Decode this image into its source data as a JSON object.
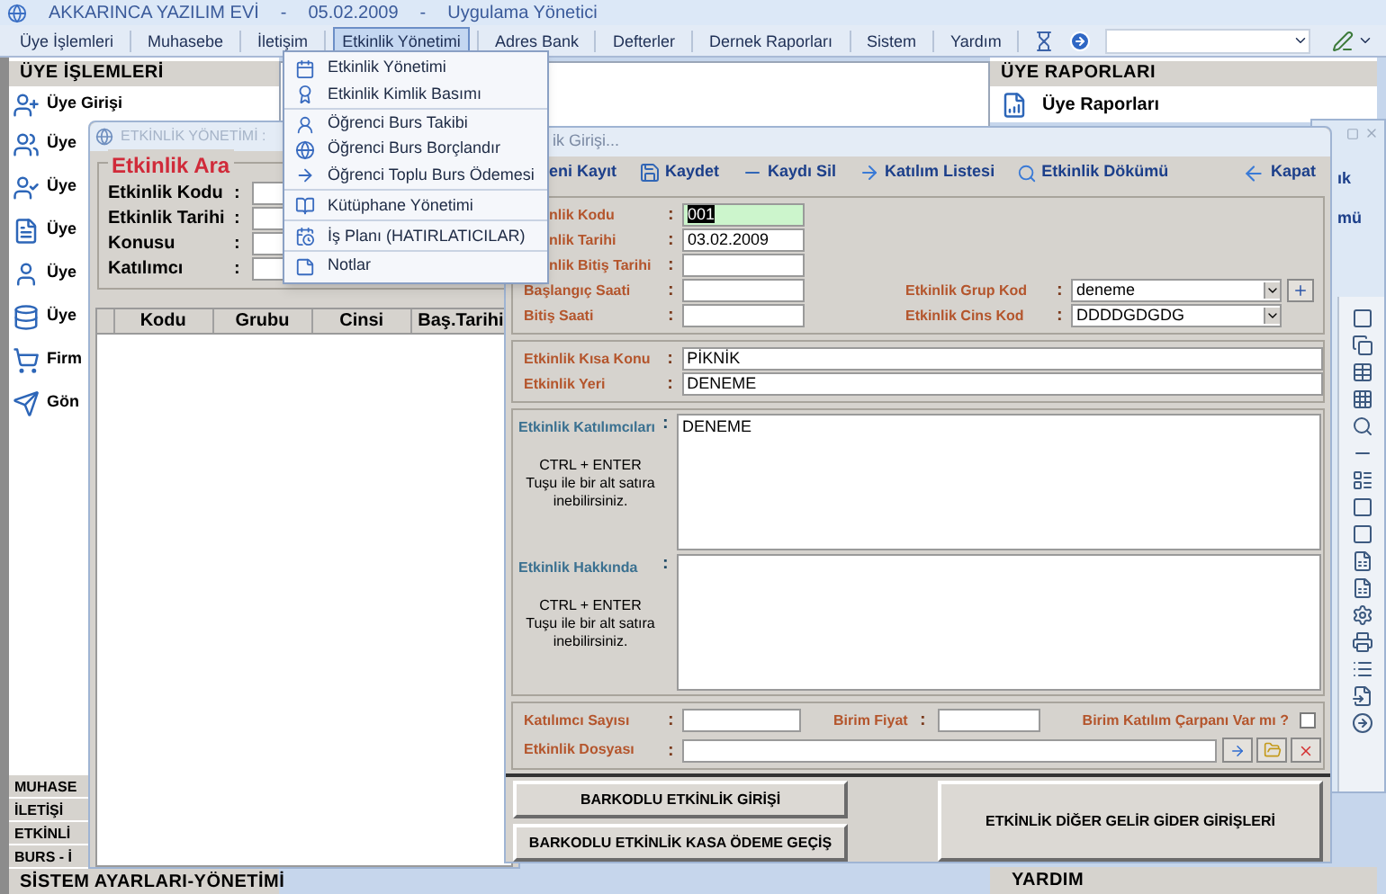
{
  "title_bar": {
    "parts": [
      "AKKARINCA YAZILIM EVİ",
      "-",
      "05.02.2009",
      "-",
      "Uygulama Yönetici"
    ]
  },
  "menu": [
    {
      "label": "Üye İşlemleri",
      "selected": false
    },
    {
      "label": "Muhasebe",
      "selected": false
    },
    {
      "label": "İletişim",
      "selected": false
    },
    {
      "label": "Etkinlik Yönetimi",
      "selected": true
    },
    {
      "label": "Adres Bank",
      "selected": false
    },
    {
      "label": "Defterler",
      "selected": false
    },
    {
      "label": "Dernek Raporları",
      "selected": false
    },
    {
      "label": "Sistem",
      "selected": false
    },
    {
      "label": "Yardım",
      "selected": false
    }
  ],
  "menu_dropdown": [
    {
      "label": "Etkinlik Yönetimi",
      "divider_after": false
    },
    {
      "label": "Etkinlik Kimlik Basımı",
      "divider_after": true
    },
    {
      "label": "Öğrenci Burs Takibi",
      "divider_after": false
    },
    {
      "label": "Öğrenci Burs Borçlandır",
      "divider_after": false
    },
    {
      "label": "Öğrenci Toplu Burs Ödemesi",
      "divider_after": true
    },
    {
      "label": "Kütüphane Yönetimi",
      "divider_after": true
    },
    {
      "label": "İş Planı (HATIRLATICILAR)",
      "divider_after": true
    },
    {
      "label": "Notlar",
      "divider_after": false
    }
  ],
  "left_panel": {
    "header": "ÜYE İŞLEMLERİ",
    "items": [
      "Üye Girişi",
      "Üye",
      "Üye",
      "Üye",
      "Üye",
      "Üye",
      "Firm",
      "Gön"
    ],
    "sections": [
      "MUHASE",
      "İLETİŞİ",
      "ETKİNLİ",
      "BURS - İ"
    ],
    "bottom_section": "SİSTEM AYARLARI-YÖNETİMİ"
  },
  "right_panel": {
    "header": "ÜYE RAPORLARI",
    "items": [
      "Üye Raporları"
    ],
    "bottom_header": "YARDIM"
  },
  "back_window": {
    "texts": [
      "ık",
      "mü"
    ]
  },
  "search_window": {
    "title": "ETKİNLİK YÖNETİMİ :",
    "group_title": "Etkinlik Ara",
    "fields": [
      {
        "label": "Etkinlik Kodu",
        "colon": ":"
      },
      {
        "label": "Etkinlik Tarihi",
        "colon": ":"
      },
      {
        "label": "Konusu",
        "colon": ":"
      },
      {
        "label": "Katılımcı",
        "colon": ":"
      }
    ],
    "columns": [
      "Kodu",
      "Grubu",
      "Cinsi",
      "Baş.Tarihi"
    ]
  },
  "entry_window": {
    "title": "ik Girişi...",
    "toolbar": [
      {
        "label": "eni Kayıt",
        "kind": "clipped"
      },
      {
        "label": "Kaydet",
        "kind": "save"
      },
      {
        "label": "Kaydı Sil",
        "kind": "delete"
      },
      {
        "label": "Katılım Listesi",
        "kind": "list"
      },
      {
        "label": "Etkinlik Dökümü",
        "kind": "report"
      }
    ],
    "close": "Kapat",
    "main_rows": [
      {
        "label": "nlik Kodu",
        "colon": ":",
        "value": "001",
        "kind": "clipped",
        "highlighted": true
      },
      {
        "label": "nlik Tarihi",
        "colon": ":",
        "value": "03.02.2009",
        "kind": "clipped",
        "highlighted": false
      },
      {
        "label": "nlik Bitiş Tarihi",
        "colon": ":",
        "kind": "clipped",
        "highlighted": false
      },
      {
        "label": "Başlangıç Saati",
        "colon": ":",
        "kind": "full",
        "highlighted": false
      },
      {
        "label": "Bitiş Saati",
        "colon": ":",
        "kind": "full",
        "highlighted": false
      }
    ],
    "side_rows": [
      {
        "label": "Etkinlik Grup Kod",
        "colon": ":",
        "value": "deneme",
        "add_button": true
      },
      {
        "label": "Etkinlik Cins Kod",
        "colon": ":",
        "value": "DDDDGDGDG",
        "add_button": false
      }
    ],
    "topic_rows": [
      {
        "label": "Etkinlik Kısa Konu",
        "colon": ":",
        "value": "PİKNİK"
      },
      {
        "label": "Etkinlik Yeri",
        "colon": ":",
        "value": "DENEME"
      }
    ],
    "text_areas": [
      {
        "label": "Etkinlik Katılımcıları",
        "colon": ":",
        "value": "DENEME",
        "hint": [
          "CTRL + ENTER",
          "Tuşu ile bir alt satıra",
          "inebilirsiniz."
        ]
      },
      {
        "label": "Etkinlik Hakkında",
        "colon": ":",
        "hint": [
          "CTRL + ENTER",
          "Tuşu ile bir alt satıra",
          "inebilirsiniz."
        ]
      }
    ],
    "count_row": {
      "participants_label": "Katılımcı Sayısı",
      "participants_colon": ":",
      "price_label": "Birim Fiyat",
      "price_colon": ":",
      "multiplier_label": "Birim Katılım Çarpanı Var mı ?",
      "multiplier_checked": false
    },
    "file_row": {
      "label": "Etkinlik Dosyası",
      "colon": ":"
    },
    "buttons": [
      {
        "label": "BARKODLU ETKİNLİK GİRİŞİ",
        "kind": "small"
      },
      {
        "label": "BARKODLU ETKİNLİK KASA ÖDEME GEÇİŞ",
        "kind": "small"
      },
      {
        "label": "ETKİNLİK DİĞER GELİR GİDER GİRİŞLERİ",
        "kind": "large"
      }
    ]
  }
}
